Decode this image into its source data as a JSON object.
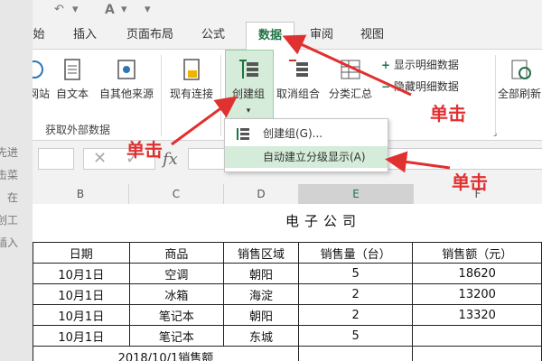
{
  "doc": {
    "lines": [
      "先进",
      "击菜",
      "，在",
      "创工",
      "插入"
    ]
  },
  "ribbon_tabs": [
    {
      "label": "始"
    },
    {
      "label": "插入"
    },
    {
      "label": "页面布局"
    },
    {
      "label": "公式"
    },
    {
      "label": "数据"
    },
    {
      "label": "审阅"
    },
    {
      "label": "视图"
    }
  ],
  "ribbon": {
    "web_label": "网站",
    "text_label": "自文本",
    "other_label": "自其他来源",
    "existing_label": "现有连接",
    "external_group": "获取外部数据",
    "group_label": "创建组",
    "ungroup_label": "取消组合",
    "subtotal_label": "分类汇总",
    "show_detail": "显示明细数据",
    "hide_detail": "隐藏明细数据",
    "refresh_label": "全部刷新"
  },
  "menu": {
    "item1": "创建组(G)...",
    "item2": "自动建立分级显示(A)"
  },
  "annotations": {
    "click": "单击"
  },
  "columns": [
    "B",
    "C",
    "D",
    "E",
    "F"
  ],
  "sheet": {
    "title": "电子公司",
    "headers": [
      "日期",
      "商品",
      "销售区域",
      "销售量（台）",
      "销售额（元）"
    ],
    "rows": [
      [
        "10月1日",
        "空调",
        "朝阳",
        "5",
        "18620"
      ],
      [
        "10月1日",
        "冰箱",
        "海淀",
        "2",
        "13200"
      ],
      [
        "10月1日",
        "笔记本",
        "朝阳",
        "2",
        "13320"
      ],
      [
        "10月1日",
        "笔记本",
        "东城",
        "5",
        ""
      ]
    ],
    "footer": "2018/10/1销售额"
  }
}
